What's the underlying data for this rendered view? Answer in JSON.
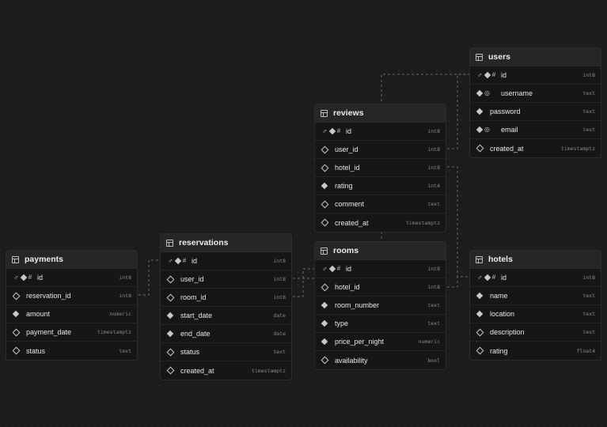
{
  "tables": {
    "users": {
      "name": "users",
      "columns": [
        {
          "name": "id",
          "type": "int8",
          "pk": true,
          "identity": true,
          "nullable": false
        },
        {
          "name": "username",
          "type": "text",
          "unique": true,
          "nullable": false
        },
        {
          "name": "password",
          "type": "text",
          "nullable": false
        },
        {
          "name": "email",
          "type": "text",
          "unique": true,
          "nullable": false
        },
        {
          "name": "created_at",
          "type": "timestamptz",
          "nullable": true
        }
      ]
    },
    "reviews": {
      "name": "reviews",
      "columns": [
        {
          "name": "id",
          "type": "int8",
          "pk": true,
          "identity": true,
          "nullable": false
        },
        {
          "name": "user_id",
          "type": "int8",
          "nullable": true
        },
        {
          "name": "hotel_id",
          "type": "int8",
          "nullable": true
        },
        {
          "name": "rating",
          "type": "int4",
          "nullable": false
        },
        {
          "name": "comment",
          "type": "text",
          "nullable": true
        },
        {
          "name": "created_at",
          "type": "timestamptz",
          "nullable": true
        }
      ]
    },
    "reservations": {
      "name": "reservations",
      "columns": [
        {
          "name": "id",
          "type": "int8",
          "pk": true,
          "identity": true,
          "nullable": false
        },
        {
          "name": "user_id",
          "type": "int8",
          "nullable": true
        },
        {
          "name": "room_id",
          "type": "int8",
          "nullable": true
        },
        {
          "name": "start_date",
          "type": "date",
          "nullable": false
        },
        {
          "name": "end_date",
          "type": "date",
          "nullable": false
        },
        {
          "name": "status",
          "type": "text",
          "nullable": true
        },
        {
          "name": "created_at",
          "type": "timestamptz",
          "nullable": true
        }
      ]
    },
    "payments": {
      "name": "payments",
      "columns": [
        {
          "name": "id",
          "type": "int8",
          "pk": true,
          "identity": true,
          "nullable": false
        },
        {
          "name": "reservation_id",
          "type": "int8",
          "nullable": true
        },
        {
          "name": "amount",
          "type": "numeric",
          "nullable": false
        },
        {
          "name": "payment_date",
          "type": "timestamptz",
          "nullable": true
        },
        {
          "name": "status",
          "type": "text",
          "nullable": true
        }
      ]
    },
    "rooms": {
      "name": "rooms",
      "columns": [
        {
          "name": "id",
          "type": "int8",
          "pk": true,
          "identity": true,
          "nullable": false
        },
        {
          "name": "hotel_id",
          "type": "int8",
          "nullable": true
        },
        {
          "name": "room_number",
          "type": "text",
          "nullable": false
        },
        {
          "name": "type",
          "type": "text",
          "nullable": false
        },
        {
          "name": "price_per_night",
          "type": "numeric",
          "nullable": false
        },
        {
          "name": "availability",
          "type": "bool",
          "nullable": true
        }
      ]
    },
    "hotels": {
      "name": "hotels",
      "columns": [
        {
          "name": "id",
          "type": "int8",
          "pk": true,
          "identity": true,
          "nullable": false
        },
        {
          "name": "name",
          "type": "text",
          "nullable": false
        },
        {
          "name": "location",
          "type": "text",
          "nullable": false
        },
        {
          "name": "description",
          "type": "text",
          "nullable": true
        },
        {
          "name": "rating",
          "type": "float4",
          "nullable": true
        }
      ]
    }
  },
  "relations": [
    {
      "from_table": "reviews",
      "from_column": "user_id",
      "to_table": "users",
      "to_column": "id"
    },
    {
      "from_table": "reviews",
      "from_column": "hotel_id",
      "to_table": "hotels",
      "to_column": "id"
    },
    {
      "from_table": "reservations",
      "from_column": "user_id",
      "to_table": "users",
      "to_column": "id"
    },
    {
      "from_table": "reservations",
      "from_column": "room_id",
      "to_table": "rooms",
      "to_column": "id"
    },
    {
      "from_table": "payments",
      "from_column": "reservation_id",
      "to_table": "reservations",
      "to_column": "id"
    },
    {
      "from_table": "rooms",
      "from_column": "hotel_id",
      "to_table": "hotels",
      "to_column": "id"
    }
  ],
  "icons": {
    "table": "table-icon",
    "primary_key": "key-icon",
    "identity": "hash-icon",
    "unique": "fingerprint-icon",
    "non_nullable": "filled-diamond-icon",
    "nullable": "hollow-diamond-icon"
  },
  "colors": {
    "canvas": "#1c1c1c",
    "table_header": "#262626",
    "table_body": "#161616",
    "connector": "#6a6a6a"
  }
}
